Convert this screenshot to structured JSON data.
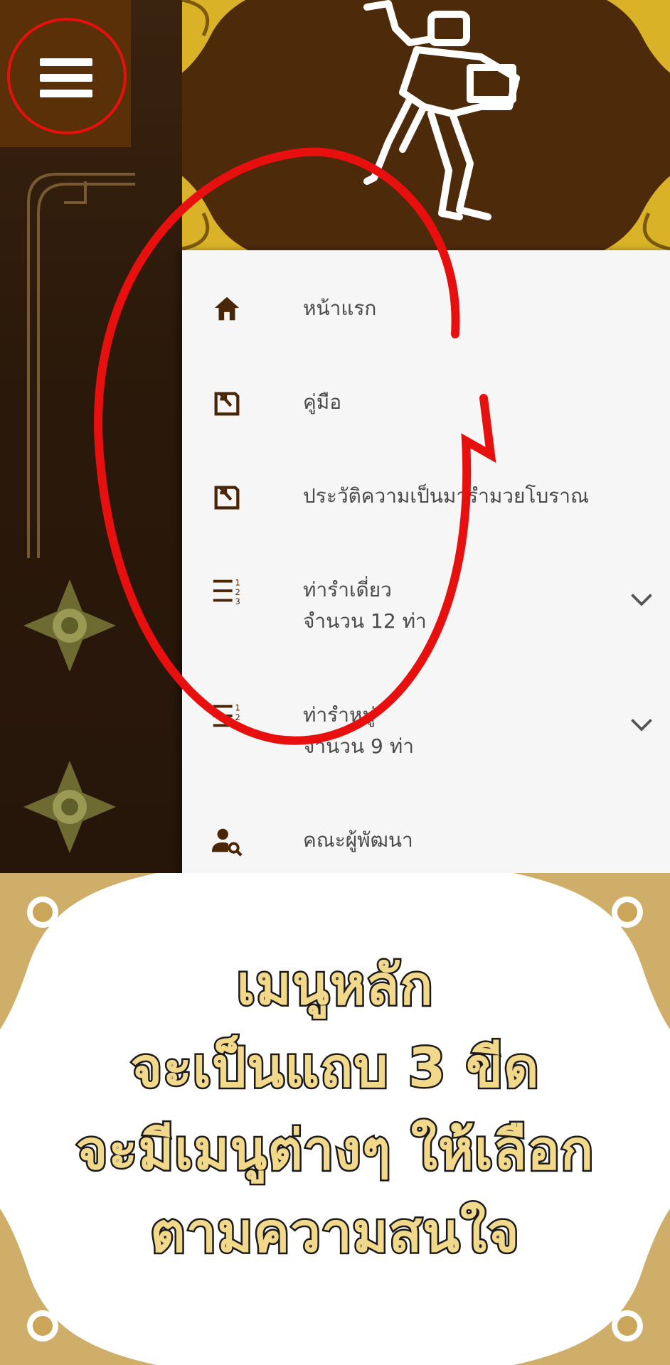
{
  "menu": {
    "items": [
      {
        "icon": "home-icon",
        "label": "หน้าแรก"
      },
      {
        "icon": "manual-icon",
        "label": "คู่มือ"
      },
      {
        "icon": "history-icon",
        "label": "ประวัติความเป็นมารำมวยโบราณ"
      },
      {
        "icon": "list-numbered-icon",
        "label": "ท่ารำเดี่ยว",
        "sub": "จำนวน 12 ท่า",
        "expandable": true
      },
      {
        "icon": "list-numbered-icon",
        "label": "ท่ารำหมู่",
        "sub": "จำนวน 9 ท่า",
        "expandable": true
      },
      {
        "icon": "person-search-icon",
        "label": "คณะผู้พัฒนา"
      }
    ]
  },
  "caption": {
    "lines": [
      "เมนูหลัก",
      "จะเป็นแถบ 3 ขีด",
      "จะมีเมนูต่างๆ ให้เลือก",
      "ตามความสนใจ"
    ]
  },
  "colors": {
    "header_brown": "#4d2a0a",
    "hamburger_bg": "#5a3009",
    "menu_bg": "#f6f6f6",
    "icon_brown": "#4a2608",
    "annotation_red": "#e8100f",
    "gold": "#e6c24a",
    "caption_fill": "#f2d88a"
  }
}
